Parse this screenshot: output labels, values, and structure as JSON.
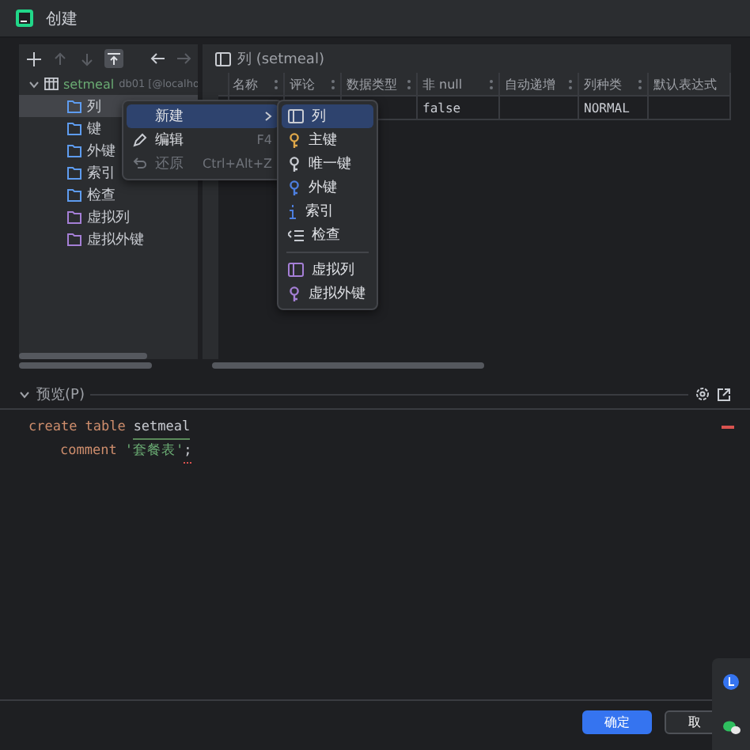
{
  "window": {
    "title": "创建"
  },
  "tree": {
    "root": {
      "name": "setmeal",
      "source": "db01 [@localho",
      "expanded": true,
      "children": [
        {
          "name": "列",
          "kind": "folder",
          "selected": true
        },
        {
          "name": "键",
          "kind": "folder",
          "selected": false
        },
        {
          "name": "外键",
          "kind": "folder",
          "selected": false
        },
        {
          "name": "索引",
          "kind": "folder",
          "selected": false
        },
        {
          "name": "检查",
          "kind": "folder",
          "selected": false
        },
        {
          "name": "虚拟列",
          "kind": "virtual",
          "selected": false
        },
        {
          "name": "虚拟外键",
          "kind": "virtual",
          "selected": false
        }
      ]
    }
  },
  "panel": {
    "title": "列 (setmeal)",
    "columns": [
      "名称",
      "评论",
      "数据类型",
      "非 null",
      "自动递增",
      "列种类",
      "默认表达式"
    ],
    "rows": [
      [
        null,
        null,
        null,
        "false",
        null,
        "NORMAL",
        null
      ]
    ]
  },
  "context_menu": [
    {
      "label": "新建",
      "kind": "submenu",
      "selected": true,
      "disabled": false
    },
    {
      "label": "编辑",
      "shortcut": "F4",
      "kind": "edit",
      "selected": false,
      "disabled": false
    },
    {
      "label": "还原",
      "shortcut": "Ctrl+Alt+Z",
      "kind": "undo",
      "selected": false,
      "disabled": true
    }
  ],
  "submenu": [
    {
      "label": "列",
      "kind": "column",
      "selected": true
    },
    {
      "label": "主键",
      "kind": "primary",
      "selected": false
    },
    {
      "label": "唯一键",
      "kind": "unique",
      "selected": false
    },
    {
      "label": "外键",
      "kind": "foreign",
      "selected": false
    },
    {
      "label": "索引",
      "kind": "index",
      "selected": false
    },
    {
      "label": "检查",
      "kind": "check",
      "selected": false
    },
    {
      "label": "虚拟列",
      "kind": "virtual-column",
      "selected": false
    },
    {
      "label": "虚拟外键",
      "kind": "virtual-key",
      "selected": false
    }
  ],
  "preview": {
    "title": "预览(P)",
    "expanded": true,
    "code": [
      [
        {
          "text": "create",
          "kind": "keyword"
        },
        {
          "text": "table",
          "kind": "keyword"
        },
        {
          "text": "setmeal",
          "kind": "identifier"
        }
      ],
      [
        {
          "text": "comment",
          "kind": "keyword"
        },
        {
          "text": "'套餐表'",
          "kind": "string"
        },
        {
          "text": ";",
          "kind": "error"
        }
      ]
    ]
  },
  "buttons": [
    {
      "label": "确定",
      "primary": true
    },
    {
      "label": "取",
      "primary": false
    }
  ]
}
